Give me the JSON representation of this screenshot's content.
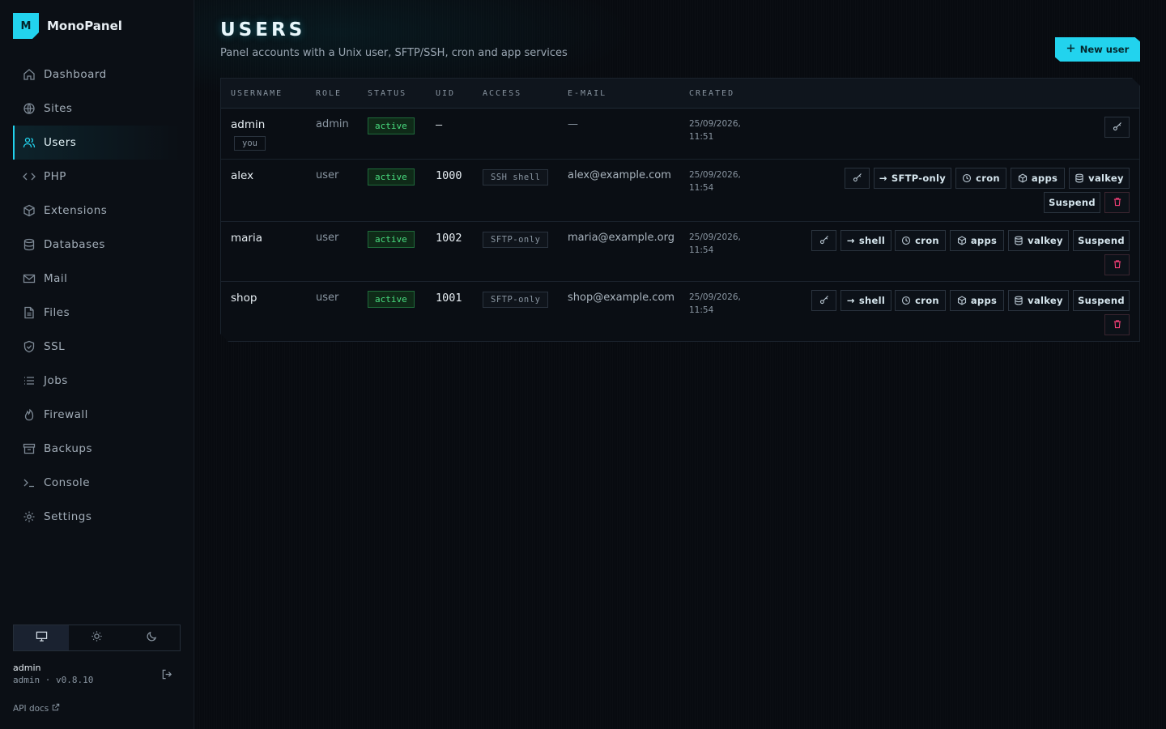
{
  "app": {
    "name": "MonoPanel",
    "logo_letter": "M"
  },
  "sidebar": {
    "items": [
      {
        "label": "Dashboard",
        "icon": "home-icon"
      },
      {
        "label": "Sites",
        "icon": "globe-icon"
      },
      {
        "label": "Users",
        "icon": "users-icon",
        "active": true
      },
      {
        "label": "PHP",
        "icon": "code-icon"
      },
      {
        "label": "Extensions",
        "icon": "package-icon"
      },
      {
        "label": "Databases",
        "icon": "database-icon"
      },
      {
        "label": "Mail",
        "icon": "mail-icon"
      },
      {
        "label": "Files",
        "icon": "file-icon"
      },
      {
        "label": "SSL",
        "icon": "shield-icon"
      },
      {
        "label": "Jobs",
        "icon": "list-icon"
      },
      {
        "label": "Firewall",
        "icon": "flame-icon"
      },
      {
        "label": "Backups",
        "icon": "archive-icon"
      },
      {
        "label": "Console",
        "icon": "terminal-icon"
      },
      {
        "label": "Settings",
        "icon": "gear-icon"
      }
    ],
    "theme_options": [
      "monitor-icon",
      "sun-icon",
      "moon-icon"
    ],
    "user": {
      "name": "admin",
      "meta": "admin · v0.8.10"
    },
    "api_docs": "API docs"
  },
  "header": {
    "title": "USERS",
    "subtitle": "Panel accounts with a Unix user, SFTP/SSH, cron and app services",
    "new_user": "New user"
  },
  "table": {
    "columns": [
      "USERNAME",
      "ROLE",
      "STATUS",
      "UID",
      "ACCESS",
      "E-MAIL",
      "CREATED"
    ],
    "rows": [
      {
        "username": "admin",
        "tag": "you",
        "role": "admin",
        "status": "active",
        "uid": "—",
        "access": "",
        "email": "—",
        "created_date": "25/09/2026,",
        "created_time": "11:51"
      },
      {
        "username": "alex",
        "role": "user",
        "status": "active",
        "uid": "1000",
        "access": "SSH shell",
        "email": "alex@example.com",
        "created_date": "25/09/2026,",
        "created_time": "11:54",
        "switch_label": "SFTP-only"
      },
      {
        "username": "maria",
        "role": "user",
        "status": "active",
        "uid": "1002",
        "access": "SFTP-only",
        "email": "maria@example.org",
        "created_date": "25/09/2026,",
        "created_time": "11:54",
        "switch_label": "shell"
      },
      {
        "username": "shop",
        "role": "user",
        "status": "active",
        "uid": "1001",
        "access": "SFTP-only",
        "email": "shop@example.com",
        "created_date": "25/09/2026,",
        "created_time": "11:54",
        "switch_label": "shell"
      }
    ],
    "actions": {
      "cron": "cron",
      "apps": "apps",
      "valkey": "valkey",
      "suspend": "Suspend"
    }
  },
  "colors": {
    "accent": "#22d3ee",
    "active_green": "#4ade80",
    "danger": "#f43f77"
  }
}
